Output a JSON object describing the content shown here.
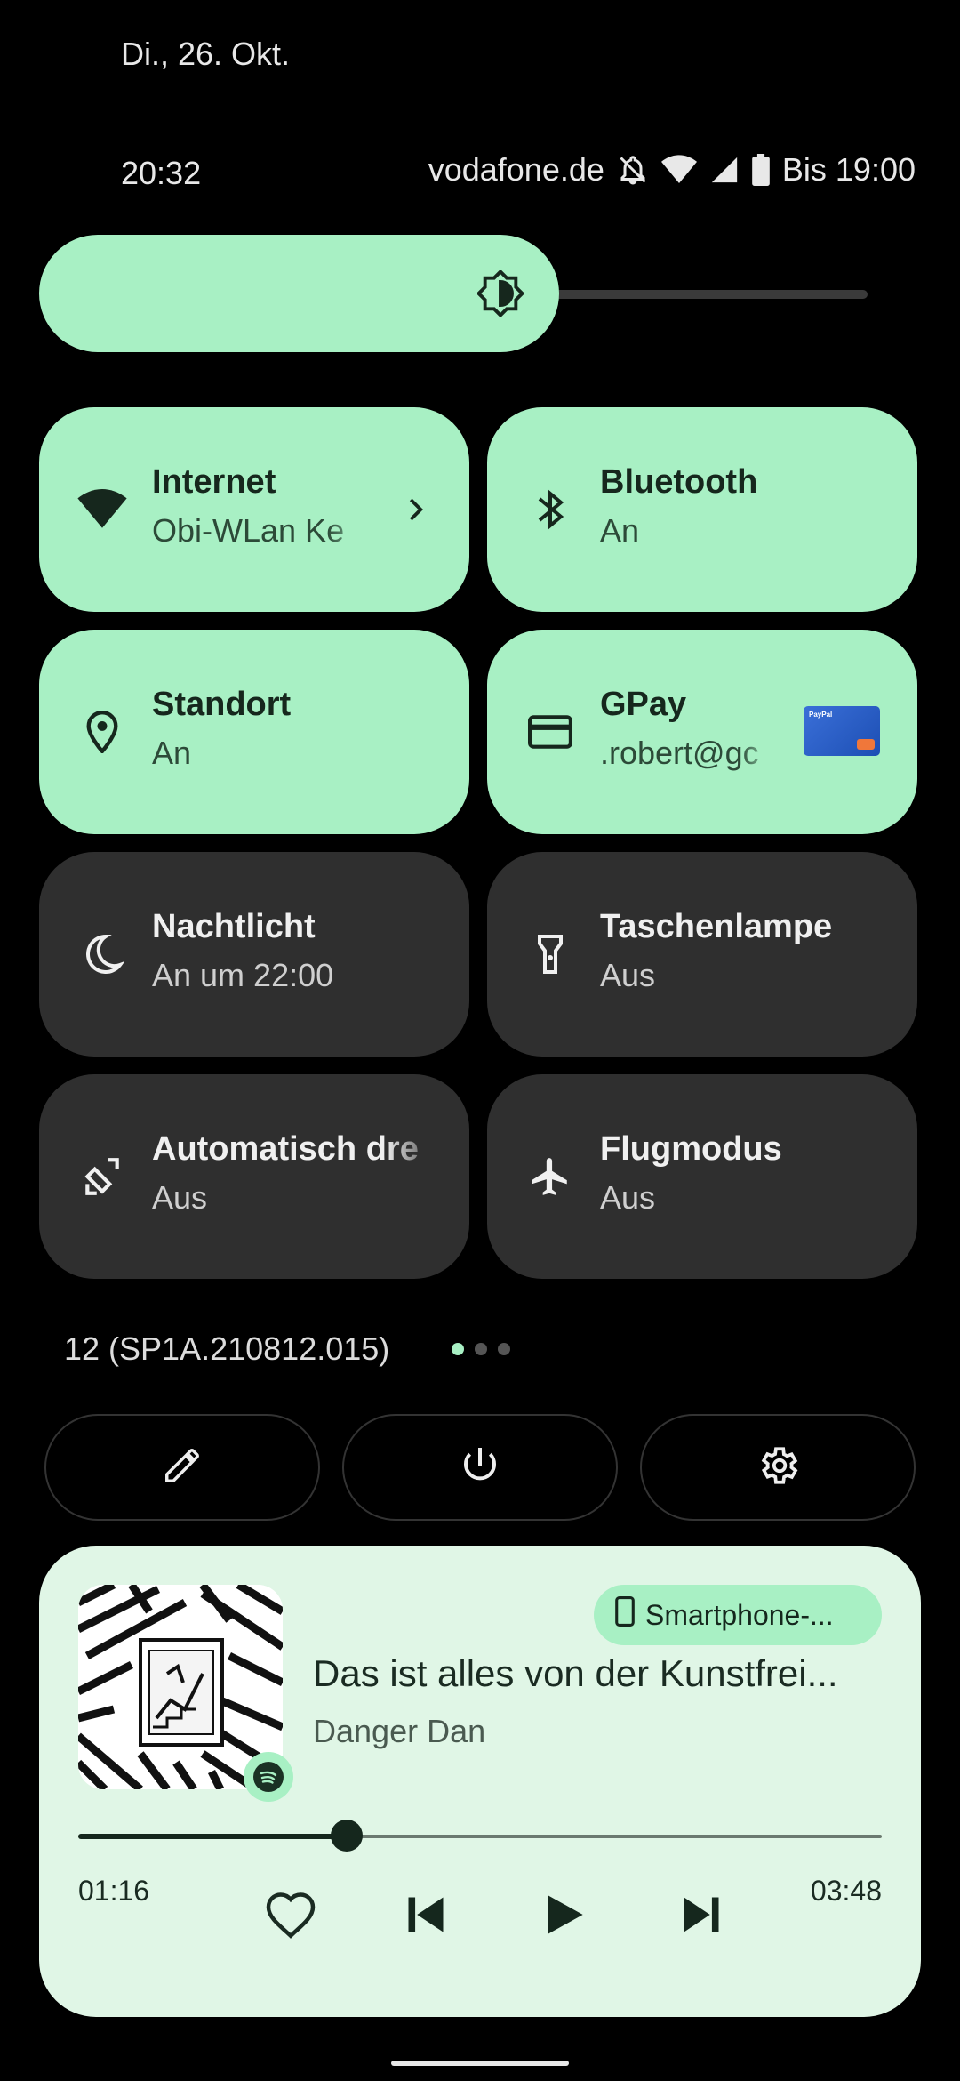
{
  "status": {
    "date": "Di., 26. Okt.",
    "time": "20:32",
    "carrier": "vodafone.de",
    "battery_text": "Bis 19:00",
    "icons": [
      "dnd-off-icon",
      "wifi-icon",
      "signal-icon",
      "battery-icon"
    ]
  },
  "brightness": {
    "level": 0.55,
    "icon": "brightness-icon"
  },
  "tiles": [
    {
      "title": "Internet",
      "subtitle": "Obi-WLan Ke",
      "state": "on",
      "icon": "wifi-icon"
    },
    {
      "title": "Bluetooth",
      "subtitle": "An",
      "state": "on",
      "icon": "bluetooth-icon"
    },
    {
      "title": "Standort",
      "subtitle": "An",
      "state": "on",
      "icon": "location-icon"
    },
    {
      "title": "GPay",
      "subtitle": ".robert@gc",
      "state": "on",
      "icon": "credit-card-icon"
    },
    {
      "title": "Nachtlicht",
      "subtitle": "An um 22:00",
      "state": "off",
      "icon": "moon-icon"
    },
    {
      "title": "Taschenlampe",
      "subtitle": "Aus",
      "state": "off",
      "icon": "flashlight-icon"
    },
    {
      "title": "Automatisch dre",
      "subtitle": "Aus",
      "state": "off",
      "icon": "auto-rotate-icon"
    },
    {
      "title": "Flugmodus",
      "subtitle": "Aus",
      "state": "off",
      "icon": "airplane-icon"
    }
  ],
  "build_number": "12 (SP1A.210812.015)",
  "pages": {
    "count": 3,
    "current": 1
  },
  "quick_buttons": [
    "edit-icon",
    "power-icon",
    "settings-icon"
  ],
  "media": {
    "output_device": "Smartphone-...",
    "title": "Das ist alles von der Kunstfrei...",
    "artist": "Danger Dan",
    "elapsed": "01:16",
    "total": "03:48",
    "progress": 0.334,
    "app_icon": "spotify-icon",
    "controls": [
      "heart-icon",
      "previous-icon",
      "play-icon",
      "next-icon"
    ]
  },
  "colors": {
    "accent": "#a8f0c4",
    "tile_off": "#2f2f2f",
    "media_bg": "#e0f6e6"
  }
}
